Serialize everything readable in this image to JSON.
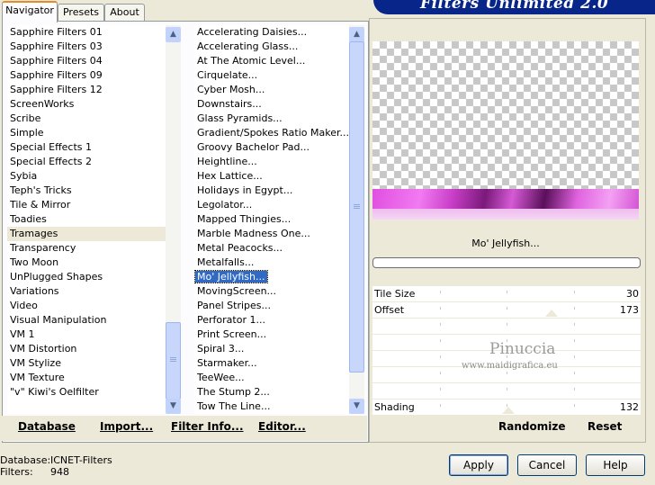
{
  "banner": {
    "title": "Filters Unlimited 2.0"
  },
  "tabs": [
    {
      "label": "Navigator",
      "active": true
    },
    {
      "label": "Presets",
      "active": false
    },
    {
      "label": "About",
      "active": false
    }
  ],
  "categories": [
    "Sapphire Filters 01",
    "Sapphire Filters 03",
    "Sapphire Filters 04",
    "Sapphire Filters 09",
    "Sapphire Filters 12",
    "ScreenWorks",
    "Scribe",
    "Simple",
    "Special Effects 1",
    "Special Effects 2",
    "Sybia",
    "Teph's Tricks",
    "Tile & Mirror",
    "Toadies",
    "Tramages",
    "Transparency",
    "Two Moon",
    "UnPlugged Shapes",
    "Variations",
    "Video",
    "Visual Manipulation",
    "VM 1",
    "VM Distortion",
    "VM Stylize",
    "VM Texture",
    "\"v\" Kiwi's Oelfilter"
  ],
  "selected_category": "Tramages",
  "filters": [
    "Accelerating Daisies...",
    "Accelerating Glass...",
    "At The Atomic Level...",
    "Cirquelate...",
    "Cyber Mosh...",
    "Downstairs...",
    "Glass Pyramids...",
    "Gradient/Spokes Ratio Maker...",
    "Groovy Bachelor Pad...",
    "Heightline...",
    "Hex Lattice...",
    "Holidays in Egypt...",
    "Legolator...",
    "Mapped Thingies...",
    "Marble Madness One...",
    "Metal Peacocks...",
    "Metalfalls...",
    "Mo' Jellyfish...",
    "MovingScreen...",
    "Panel Stripes...",
    "Perforator 1...",
    "Print Screen...",
    "Spiral 3...",
    "Starmaker...",
    "TeeWee...",
    "The Stump 2...",
    "Tow The Line..."
  ],
  "selected_filter": "Mo' Jellyfish...",
  "bottom_left_buttons": {
    "database": "Database",
    "import": "Import...",
    "filter_info": "Filter Info...",
    "editor": "Editor..."
  },
  "preview": {
    "filter_name": "Mo' Jellyfish..."
  },
  "sliders": [
    {
      "label": "Tile Size",
      "value": "30"
    },
    {
      "label": "Offset",
      "value": "173"
    },
    {
      "label": "Shading",
      "value": "132"
    }
  ],
  "watermark": {
    "line1": "Pinuccia",
    "line2": "www.maidigrafica.eu"
  },
  "right_buttons": {
    "randomize": "Randomize",
    "reset": "Reset"
  },
  "status": {
    "database_label": "Database:",
    "database_value": "ICNET-Filters",
    "filters_label": "Filters:",
    "filters_value": "948"
  },
  "dialog_buttons": {
    "apply": "Apply",
    "cancel": "Cancel",
    "help": "Help"
  }
}
